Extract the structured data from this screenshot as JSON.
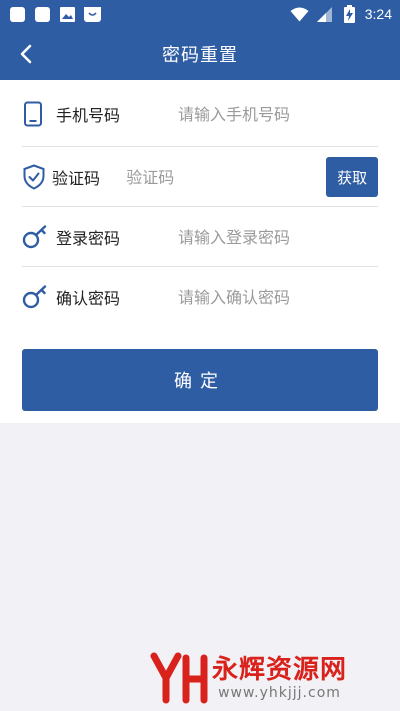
{
  "status_bar": {
    "time": "3:24",
    "left_icons": [
      "app-square-icon",
      "app-square-icon",
      "image-icon",
      "shopping-bag-icon"
    ],
    "right_icons": [
      "wifi-icon",
      "signal-icon",
      "battery-charging-icon"
    ]
  },
  "header": {
    "title": "密码重置",
    "back_icon": "back-chevron-icon"
  },
  "form": {
    "rows": [
      {
        "icon": "phone-icon",
        "label": "手机号码",
        "placeholder": "请输入手机号码",
        "value": ""
      },
      {
        "icon": "shield-check-icon",
        "label": "验证码",
        "placeholder": "验证码",
        "value": ""
      },
      {
        "icon": "key-icon",
        "label": "登录密码",
        "placeholder": "请输入登录密码",
        "value": ""
      },
      {
        "icon": "key-icon",
        "label": "确认密码",
        "placeholder": "请输入确认密码",
        "value": ""
      }
    ],
    "get_code_label": "获取",
    "confirm_label": "确定"
  },
  "watermark": {
    "name": "永辉资源网",
    "url": "www.yhkjjj.com"
  },
  "colors": {
    "brand": "#2e5da3",
    "background": "#f2f2f6",
    "watermark_red": "#d9221c"
  }
}
